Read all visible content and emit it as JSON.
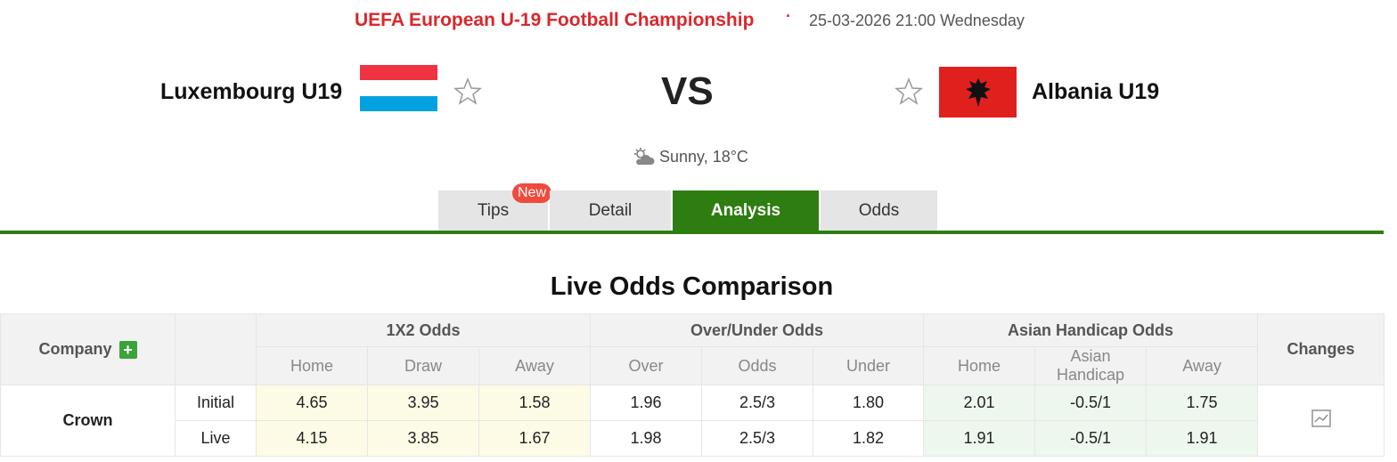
{
  "match": {
    "league": "UEFA European U-19 Football Championship",
    "separator": "·",
    "datetime": "25-03-2026 21:00 Wednesday",
    "home": "Luxembourg U19",
    "away": "Albania U19",
    "vs": "VS",
    "weather": "Sunny, 18°C"
  },
  "tabs": [
    {
      "label": "Tips",
      "badge": "New"
    },
    {
      "label": "Detail"
    },
    {
      "label": "Analysis",
      "active": true
    },
    {
      "label": "Odds"
    }
  ],
  "section_title": "Live Odds Comparison",
  "table": {
    "company_header": "Company",
    "groups": [
      "1X2 Odds",
      "Over/Under Odds",
      "Asian Handicap Odds"
    ],
    "changes_header": "Changes",
    "subheaders": [
      "Home",
      "Draw",
      "Away",
      "Over",
      "Odds",
      "Under",
      "Home",
      "Asian Handicap",
      "Away"
    ],
    "company": "Crown",
    "rows": [
      {
        "label": "Initial",
        "values": [
          "4.65",
          "3.95",
          "1.58",
          "1.96",
          "2.5/3",
          "1.80",
          "2.01",
          "-0.5/1",
          "1.75"
        ]
      },
      {
        "label": "Live",
        "values": [
          "4.15",
          "3.85",
          "1.67",
          "1.98",
          "2.5/3",
          "1.82",
          "1.91",
          "-0.5/1",
          "1.91"
        ]
      }
    ]
  },
  "colors": {
    "league": "#d8282c",
    "tab_active": "#2e7d11",
    "badge": "#f04a3e",
    "luxembourg_flag": [
      "#ef3340",
      "#ffffff",
      "#00a3e0"
    ],
    "albania_flag": "#e0201c"
  },
  "icons": [
    "star-icon",
    "weather-icon",
    "plus-icon",
    "chart-icon"
  ]
}
